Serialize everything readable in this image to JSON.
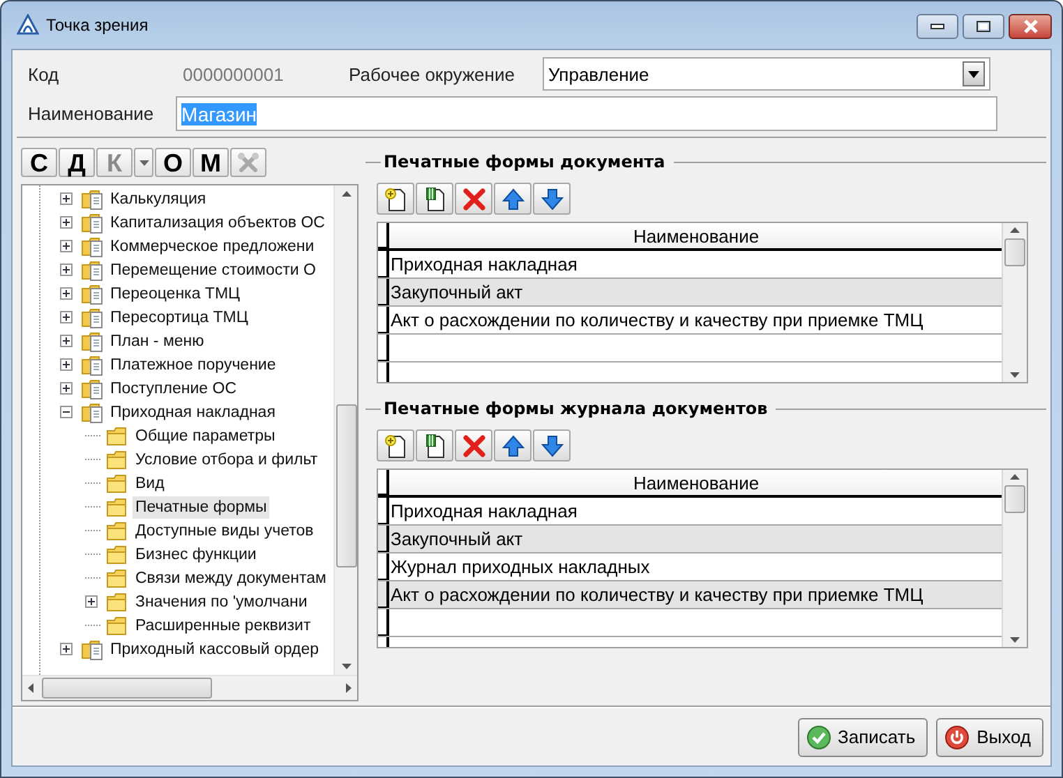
{
  "window": {
    "title": "Точка зрения"
  },
  "form": {
    "code_label": "Код",
    "code_value": "0000000001",
    "environment_label": "Рабочее окружение",
    "environment_value": "Управление",
    "name_label": "Наименование",
    "name_value": "Магазин",
    "name_selected": true
  },
  "tree_toolbar": [
    {
      "kind": "text",
      "label": "С",
      "disabled": false,
      "dropdown": false
    },
    {
      "kind": "text",
      "label": "Д",
      "disabled": false,
      "dropdown": false
    },
    {
      "kind": "text",
      "label": "К",
      "disabled": true,
      "dropdown": true
    },
    {
      "kind": "text",
      "label": "О",
      "disabled": false,
      "dropdown": false
    },
    {
      "kind": "text",
      "label": "М",
      "disabled": false,
      "dropdown": false
    },
    {
      "kind": "icon",
      "disabled": true,
      "dropdown": false
    }
  ],
  "tree": [
    {
      "label": "Калькуляция",
      "kind": "document-folder",
      "expanded": false,
      "selected": false
    },
    {
      "label": "Капитализация объектов ОС",
      "kind": "document-folder",
      "expanded": false,
      "selected": false
    },
    {
      "label": "Коммерческое предложени",
      "kind": "document-folder",
      "expanded": false,
      "selected": false
    },
    {
      "label": "Перемещение стоимости О",
      "kind": "document-folder",
      "expanded": false,
      "selected": false
    },
    {
      "label": "Переоценка ТМЦ",
      "kind": "document-folder",
      "expanded": false,
      "selected": false
    },
    {
      "label": "Пересортица ТМЦ",
      "kind": "document-folder",
      "expanded": false,
      "selected": false
    },
    {
      "label": "План - меню",
      "kind": "document-folder",
      "expanded": false,
      "selected": false
    },
    {
      "label": "Платежное поручение",
      "kind": "document-folder",
      "expanded": false,
      "selected": false
    },
    {
      "label": "Поступление ОС",
      "kind": "document-folder",
      "expanded": false,
      "selected": false
    },
    {
      "label": "Приходная накладная",
      "kind": "document-folder",
      "expanded": true,
      "selected": false,
      "children": [
        {
          "label": "Общие параметры",
          "kind": "folder",
          "selected": false
        },
        {
          "label": "Условие отбора и фильт",
          "kind": "folder",
          "selected": false
        },
        {
          "label": "Вид",
          "kind": "folder",
          "selected": false
        },
        {
          "label": "Печатные формы",
          "kind": "folder",
          "selected": true
        },
        {
          "label": "Доступные виды учетов",
          "kind": "folder",
          "selected": false
        },
        {
          "label": "Бизнес функции",
          "kind": "folder",
          "selected": false
        },
        {
          "label": "Связи между документам",
          "kind": "folder",
          "selected": false
        },
        {
          "label": "Значения по 'умолчани",
          "kind": "folder",
          "expanded": false,
          "selected": false
        },
        {
          "label": "Расширенные реквизит",
          "kind": "folder",
          "selected": false
        }
      ]
    },
    {
      "label": "Приходный кассовый ордер",
      "kind": "document-folder",
      "expanded": false,
      "selected": false
    }
  ],
  "sections": [
    {
      "title": "Печатные формы документа",
      "toolbar": [
        {
          "kind": "add"
        },
        {
          "kind": "edit"
        },
        {
          "kind": "delete"
        },
        {
          "kind": "up"
        },
        {
          "kind": "down"
        }
      ],
      "columns": [
        "Наименование"
      ],
      "rows": [
        "Приходная накладная",
        "Закупочный акт",
        "Акт о расхождении по количеству и качеству при приемке ТМЦ"
      ]
    },
    {
      "title": "Печатные формы журнала документов",
      "toolbar": [
        {
          "kind": "add"
        },
        {
          "kind": "edit"
        },
        {
          "kind": "delete"
        },
        {
          "kind": "up"
        },
        {
          "kind": "down"
        }
      ],
      "columns": [
        "Наименование"
      ],
      "rows": [
        "Приходная накладная",
        "Закупочный акт",
        "Журнал приходных накладных",
        "Акт о расхождении по количеству и качеству при приемке ТМЦ"
      ]
    }
  ],
  "buttons": [
    {
      "label": "Записать",
      "kind": "save"
    },
    {
      "label": "Выход",
      "kind": "exit"
    }
  ]
}
